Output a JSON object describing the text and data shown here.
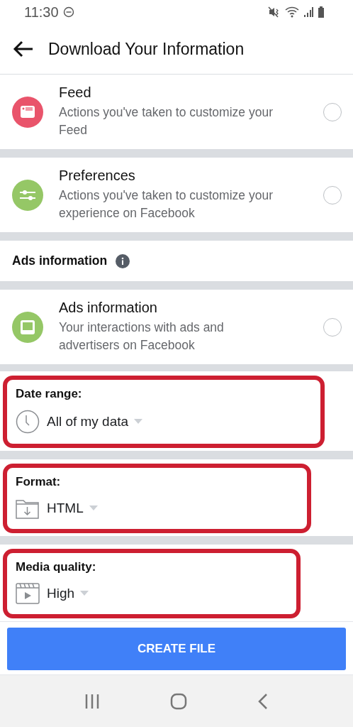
{
  "status_bar": {
    "time": "11:30"
  },
  "header": {
    "title": "Download Your Information"
  },
  "categories": [
    {
      "kind": "feed",
      "color": "#e9546b",
      "title": "Feed",
      "description": "Actions you've taken to customize your Feed",
      "selected": false
    },
    {
      "kind": "preferences",
      "color": "#95c766",
      "title": "Preferences",
      "description": "Actions you've taken to customize your experience on Facebook",
      "selected": false
    }
  ],
  "section": {
    "title": "Ads information"
  },
  "section_items": [
    {
      "kind": "ads",
      "color": "#95c766",
      "title": "Ads information",
      "description": "Your interactions with ads and advertisers on Facebook",
      "selected": false
    }
  ],
  "settings": [
    {
      "kind": "clock",
      "label": "Date range:",
      "value": "All of my data",
      "highlighted": true
    },
    {
      "kind": "folder",
      "label": "Format:",
      "value": "HTML",
      "highlighted": true
    },
    {
      "kind": "film",
      "label": "Media quality:",
      "value": "High",
      "highlighted": true
    }
  ],
  "create_button": {
    "label": "CREATE FILE"
  }
}
